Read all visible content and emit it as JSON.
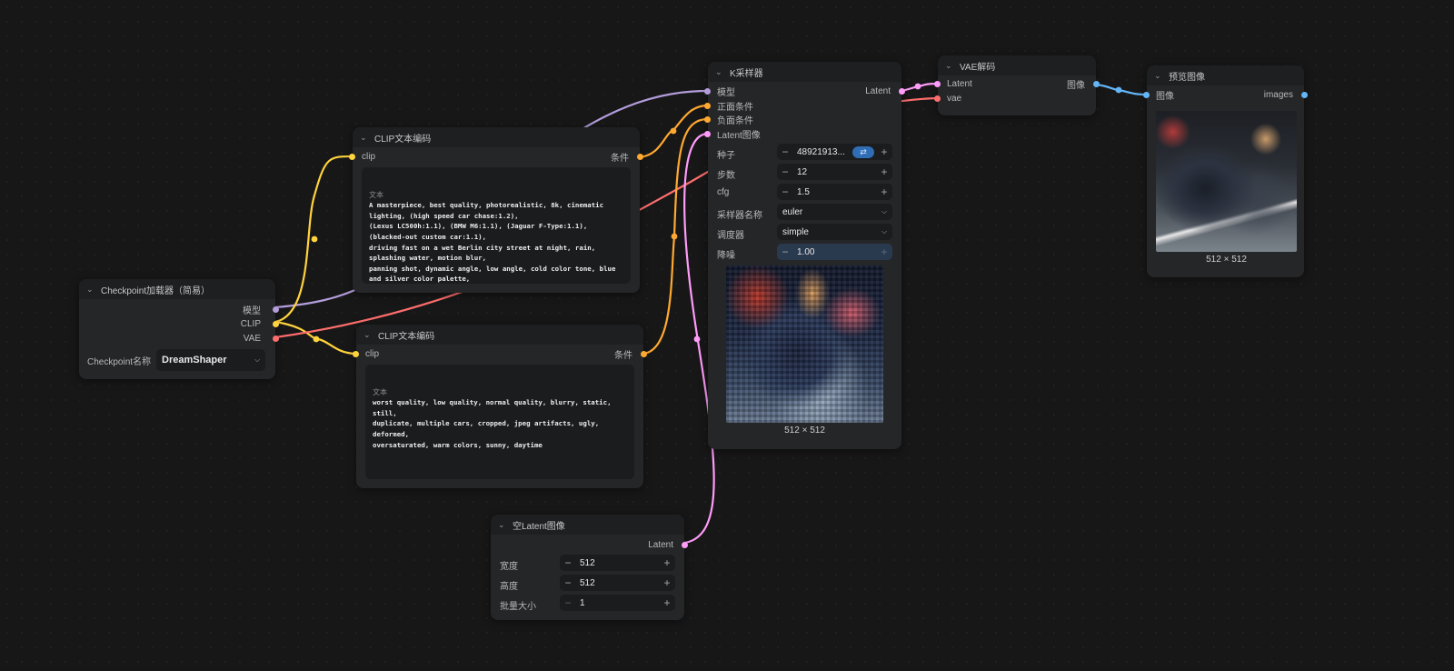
{
  "colors": {
    "model": "#b39ddb",
    "clip": "#ffd33d",
    "vae": "#ff6e6e",
    "conditioning": "#ffa931",
    "latent": "#ff9cf9",
    "image": "#64b5f6"
  },
  "checkpoint_node": {
    "title": "Checkpoint加载器（简易）",
    "outputs": [
      "模型",
      "CLIP",
      "VAE"
    ],
    "widget_label": "Checkpoint名称",
    "widget_value": "DreamShaper"
  },
  "clip_pos_node": {
    "title": "CLIP文本编码",
    "input": "clip",
    "output": "条件",
    "text_label": "文本",
    "text": "A masterpiece, best quality, photorealistic, 8k, cinematic lighting, (high speed car chase:1.2),\n(Lexus LC500h:1.1), (BMW M6:1.1), (Jaguar F-Type:1.1), (blacked-out custom car:1.1),\ndriving fast on a wet Berlin city street at night, rain, splashing water, motion blur,\npanning shot, dynamic angle, low angle, cold color tone, blue and silver color palette,\naggressive, menacing atmosphere, city lights bokeh in background, wet asphalt reflection"
  },
  "clip_neg_node": {
    "title": "CLIP文本编码",
    "input": "clip",
    "output": "条件",
    "text_label": "文本",
    "text": "worst quality, low quality, normal quality, blurry, static, still,\nduplicate, multiple cars, cropped, jpeg artifacts, ugly, deformed,\noversaturated, warm colors, sunny, daytime"
  },
  "ksampler_node": {
    "title": "K采样器",
    "inputs": [
      "模型",
      "正面条件",
      "负面条件",
      "Latent图像"
    ],
    "output": "Latent",
    "widgets": [
      {
        "label": "种子",
        "value": "48921913..."
      },
      {
        "label": "步数",
        "value": "12"
      },
      {
        "label": "cfg",
        "value": "1.5"
      },
      {
        "label": "采样器名称",
        "value": "euler"
      },
      {
        "label": "调度器",
        "value": "simple"
      },
      {
        "label": "降噪",
        "value": "1.00"
      }
    ],
    "preview_caption": "512 × 512"
  },
  "vae_decode_node": {
    "title": "VAE解码",
    "inputs": [
      "Latent",
      "vae"
    ],
    "output": "图像"
  },
  "preview_node": {
    "title": "预览图像",
    "input": "图像",
    "output": "images",
    "caption": "512 × 512"
  },
  "empty_latent_node": {
    "title": "空Latent图像",
    "output": "Latent",
    "widgets": [
      {
        "label": "宽度",
        "value": "512"
      },
      {
        "label": "高度",
        "value": "512"
      },
      {
        "label": "批量大小",
        "value": "1"
      }
    ]
  }
}
